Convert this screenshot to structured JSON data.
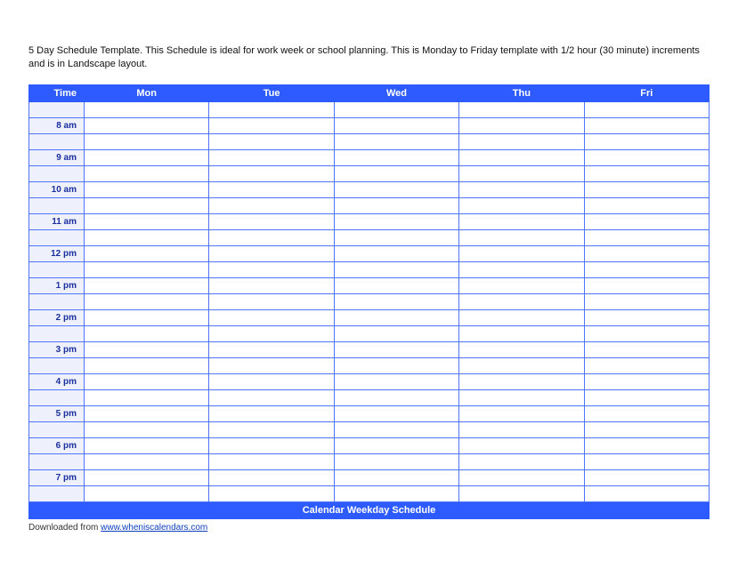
{
  "description": "5 Day Schedule Template.  This Schedule is ideal for work week or school planning.  This is Monday to Friday template with 1/2 hour (30 minute) increments and is in Landscape layout.",
  "header": {
    "time": "Time",
    "days": [
      "Mon",
      "Tue",
      "Wed",
      "Thu",
      "Fri"
    ]
  },
  "time_slots": [
    "",
    "8 am",
    "",
    "9 am",
    "",
    "10 am",
    "",
    "11 am",
    "",
    "12 pm",
    "",
    "1 pm",
    "",
    "2 pm",
    "",
    "3 pm",
    "",
    "4 pm",
    "",
    "5 pm",
    "",
    "6 pm",
    "",
    "7 pm",
    ""
  ],
  "footer_title": "Calendar Weekday Schedule",
  "download_prefix": "Downloaded from ",
  "download_link_text": "www.wheniscalendars.com"
}
